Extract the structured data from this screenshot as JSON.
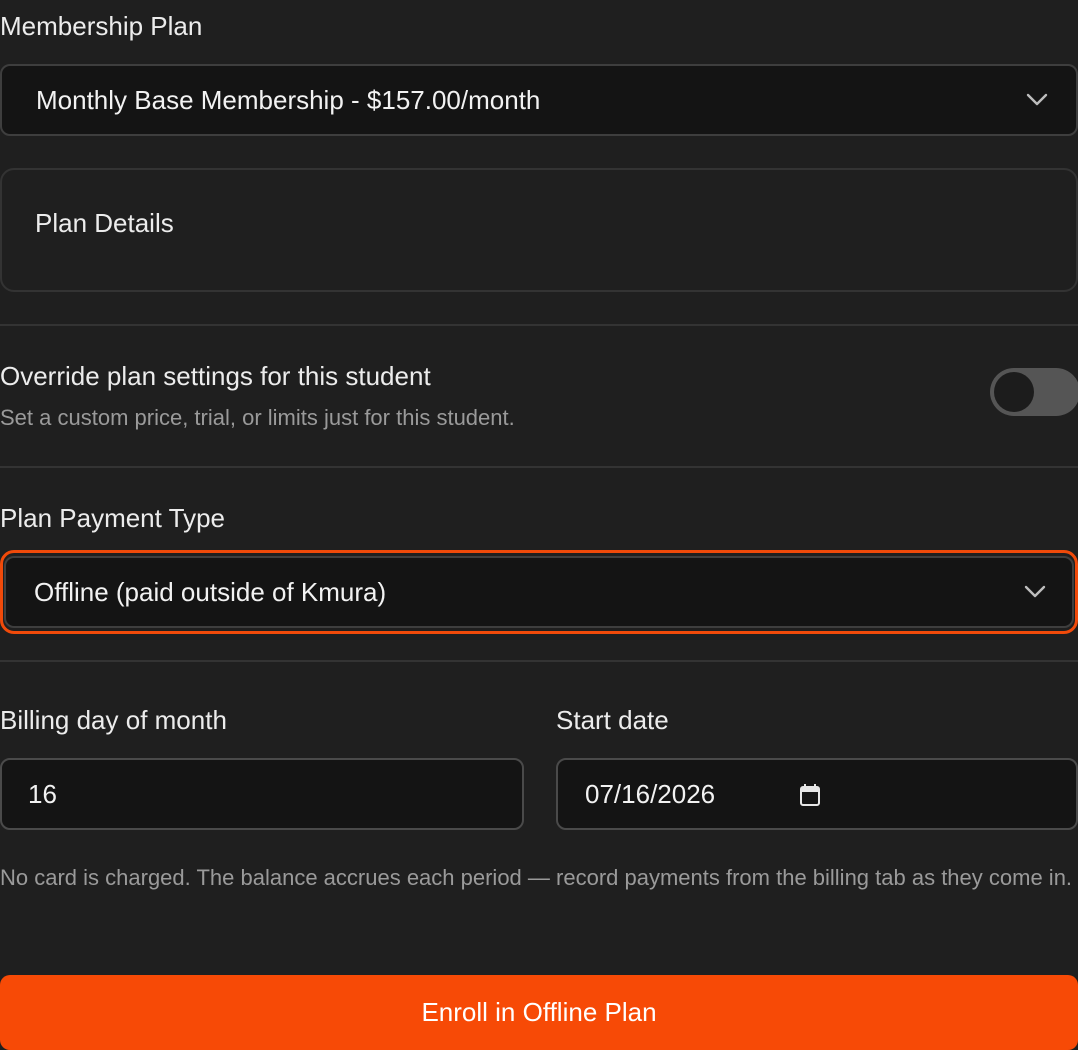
{
  "membership_plan": {
    "label": "Membership Plan",
    "selected": "Monthly Base Membership - $157.00/month"
  },
  "plan_details": {
    "title": "Plan Details"
  },
  "override": {
    "title": "Override plan settings for this student",
    "description": "Set a custom price, trial, or limits just for this student.",
    "enabled": false
  },
  "payment_type": {
    "label": "Plan Payment Type",
    "selected": "Offline (paid outside of Kmura)"
  },
  "billing_day": {
    "label": "Billing day of month",
    "value": "16"
  },
  "start_date": {
    "label": "Start date",
    "value": "07/16/2026"
  },
  "note": "No card is charged. The balance accrues each period — record payments from the billing tab as they come in.",
  "enroll_button": {
    "label": "Enroll in Offline Plan"
  },
  "colors": {
    "accent": "#f74a06",
    "background": "#1f1f1f",
    "input_background": "#141414"
  },
  "icons": {
    "select_chevron": "chevron-down-icon",
    "date_picker": "calendar-icon"
  }
}
